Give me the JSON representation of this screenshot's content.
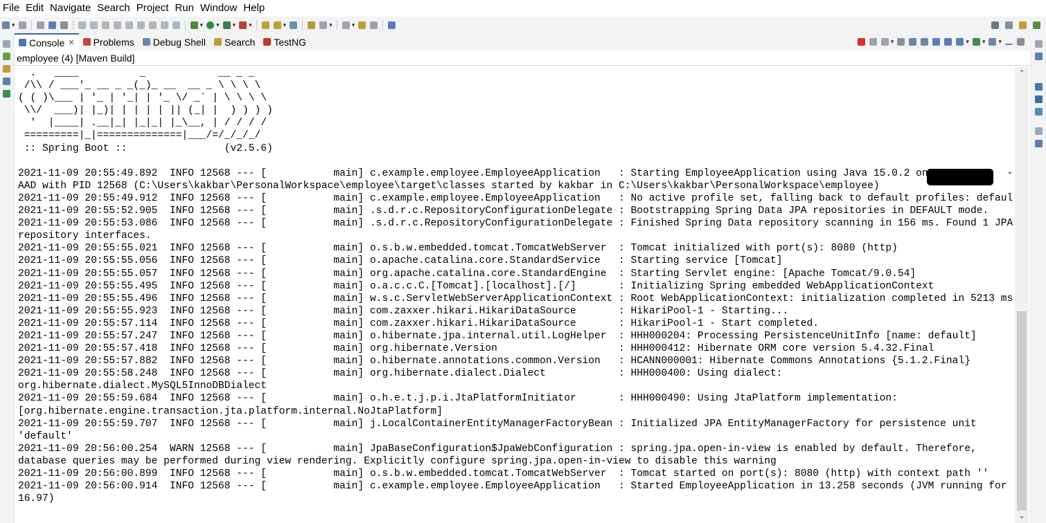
{
  "menubar": {
    "items": [
      {
        "label": "File"
      },
      {
        "label": "Edit"
      },
      {
        "label": "Navigate"
      },
      {
        "label": "Search"
      },
      {
        "label": "Project"
      },
      {
        "label": "Run"
      },
      {
        "label": "Window"
      },
      {
        "label": "Help"
      }
    ]
  },
  "tabs": [
    {
      "label": "Console",
      "icon": "console-icon",
      "active": true,
      "closable": true
    },
    {
      "label": "Problems",
      "icon": "problems-icon"
    },
    {
      "label": "Debug Shell",
      "icon": "debug-shell-icon"
    },
    {
      "label": "Search",
      "icon": "search-icon"
    },
    {
      "label": "TestNG",
      "icon": "testng-icon"
    }
  ],
  "console": {
    "process_label": "employee (4) [Maven Build]",
    "lines": [
      "  .   ____          _            __ _ _",
      " /\\\\ / ___'_ __ _ _(_)_ __  __ _ \\ \\ \\ \\",
      "( ( )\\___ | '_ | '_| | '_ \\/ _` | \\ \\ \\ \\",
      " \\\\/  ___)| |_)| | | | | || (_| |  ) ) ) )",
      "  '  |____| .__|_| |_|_| |_\\__, | / / / /",
      " =========|_|==============|___/=/_/_/_/",
      " :: Spring Boot ::                (v2.5.6)",
      "",
      "2021-11-09 20:55:49.892  INFO 12568 --- [           main] c.example.employee.EmployeeApplication   : Starting EmployeeApplication using Java 15.0.2 on I           -",
      "AAD with PID 12568 (C:\\Users\\kakbar\\PersonalWorkspace\\employee\\target\\classes started by kakbar in C:\\Users\\kakbar\\PersonalWorkspace\\employee)",
      "2021-11-09 20:55:49.912  INFO 12568 --- [           main] c.example.employee.EmployeeApplication   : No active profile set, falling back to default profiles: default",
      "2021-11-09 20:55:52.905  INFO 12568 --- [           main] .s.d.r.c.RepositoryConfigurationDelegate : Bootstrapping Spring Data JPA repositories in DEFAULT mode.",
      "2021-11-09 20:55:53.086  INFO 12568 --- [           main] .s.d.r.c.RepositoryConfigurationDelegate : Finished Spring Data repository scanning in 156 ms. Found 1 JPA",
      "repository interfaces.",
      "2021-11-09 20:55:55.021  INFO 12568 --- [           main] o.s.b.w.embedded.tomcat.TomcatWebServer  : Tomcat initialized with port(s): 8080 (http)",
      "2021-11-09 20:55:55.056  INFO 12568 --- [           main] o.apache.catalina.core.StandardService   : Starting service [Tomcat]",
      "2021-11-09 20:55:55.057  INFO 12568 --- [           main] org.apache.catalina.core.StandardEngine  : Starting Servlet engine: [Apache Tomcat/9.0.54]",
      "2021-11-09 20:55:55.495  INFO 12568 --- [           main] o.a.c.c.C.[Tomcat].[localhost].[/]       : Initializing Spring embedded WebApplicationContext",
      "2021-11-09 20:55:55.496  INFO 12568 --- [           main] w.s.c.ServletWebServerApplicationContext : Root WebApplicationContext: initialization completed in 5213 ms",
      "2021-11-09 20:55:55.923  INFO 12568 --- [           main] com.zaxxer.hikari.HikariDataSource       : HikariPool-1 - Starting...",
      "2021-11-09 20:55:57.114  INFO 12568 --- [           main] com.zaxxer.hikari.HikariDataSource       : HikariPool-1 - Start completed.",
      "2021-11-09 20:55:57.247  INFO 12568 --- [           main] o.hibernate.jpa.internal.util.LogHelper  : HHH000204: Processing PersistenceUnitInfo [name: default]",
      "2021-11-09 20:55:57.418  INFO 12568 --- [           main] org.hibernate.Version                    : HHH000412: Hibernate ORM core version 5.4.32.Final",
      "2021-11-09 20:55:57.882  INFO 12568 --- [           main] o.hibernate.annotations.common.Version   : HCANN000001: Hibernate Commons Annotations {5.1.2.Final}",
      "2021-11-09 20:55:58.248  INFO 12568 --- [           main] org.hibernate.dialect.Dialect            : HHH000400: Using dialect:",
      "org.hibernate.dialect.MySQL5InnoDBDialect",
      "2021-11-09 20:55:59.684  INFO 12568 --- [           main] o.h.e.t.j.p.i.JtaPlatformInitiator       : HHH000490: Using JtaPlatform implementation:",
      "[org.hibernate.engine.transaction.jta.platform.internal.NoJtaPlatform]",
      "2021-11-09 20:55:59.707  INFO 12568 --- [           main] j.LocalContainerEntityManagerFactoryBean : Initialized JPA EntityManagerFactory for persistence unit",
      "'default'",
      "2021-11-09 20:56:00.254  WARN 12568 --- [           main] JpaBaseConfiguration$JpaWebConfiguration : spring.jpa.open-in-view is enabled by default. Therefore,",
      "database queries may be performed during view rendering. Explicitly configure spring.jpa.open-in-view to disable this warning",
      "2021-11-09 20:56:00.899  INFO 12568 --- [           main] o.s.b.w.embedded.tomcat.TomcatWebServer  : Tomcat started on port(s): 8080 (http) with context path ''",
      "2021-11-09 20:56:00.914  INFO 12568 --- [           main] c.example.employee.EmployeeApplication   : Started EmployeeApplication in 13.258 seconds (JVM running for",
      "16.97)"
    ]
  },
  "colors": {
    "active_tab_accent": "#3a6ea5",
    "terminate_red": "#d9302c",
    "run_green": "#2e8b3a"
  },
  "icons": {
    "toolbar_left": [
      "new-icon",
      "save-icon",
      "save-all-icon",
      "properties-icon",
      "skip-breakpoints-icon",
      "resume-icon",
      "suspend-icon",
      "terminate-icon",
      "disconnect-icon",
      "step-into-icon",
      "step-over-icon",
      "step-return-icon",
      "drop-to-frame-icon",
      "use-step-filters-icon",
      "debug-icon",
      "run-icon",
      "coverage-icon",
      "external-tools-icon",
      "new-java-project-icon",
      "open-type-icon",
      "search-icon",
      "toggle-mark-occurrences-icon",
      "annotation-next-icon",
      "annotation-prev-icon",
      "back-icon",
      "forward-icon",
      "pin-editor-icon"
    ],
    "toolbar_right": [
      "quick-access-search-icon",
      "open-perspective-icon",
      "java-perspective-icon",
      "debug-perspective-icon"
    ],
    "console_tools": [
      "terminate-icon",
      "remove-launch-icon",
      "remove-all-terminated-icon",
      "clear-console-icon",
      "scroll-lock-icon",
      "word-wrap-icon",
      "show-on-stdout-icon",
      "show-on-stderr-icon",
      "pin-console-icon",
      "display-selected-console-icon",
      "open-console-icon",
      "minimize-icon",
      "maximize-icon"
    ]
  }
}
